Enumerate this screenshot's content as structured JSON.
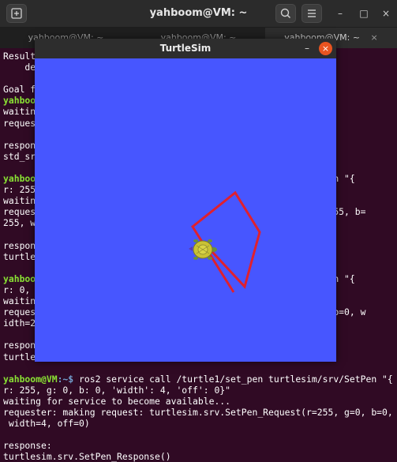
{
  "terminal": {
    "title": "yahboom@VM: ~",
    "new_tab_icon": "new-tab-icon",
    "search_icon": "search-icon",
    "menu_icon": "hamburger-menu-icon",
    "minimize_label": "–",
    "maximize_label": "□",
    "close_label": "×",
    "tabs": [
      {
        "label": "yahboom@VM: ~"
      },
      {
        "label": "yahboom@VM: ~"
      },
      {
        "label": "yahboom@VM: ~"
      }
    ],
    "tab_close_label": "×",
    "lines": [
      {
        "text": "Result"
      },
      {
        "text": "    de"
      },
      {
        "text": ""
      },
      {
        "text": "Goal f"
      },
      {
        "user": "yahboo",
        "text": ""
      },
      {
        "text": "waitin"
      },
      {
        "text": "reques"
      },
      {
        "text": ""
      },
      {
        "text": "respon"
      },
      {
        "text": "std_sr"
      },
      {
        "text": ""
      },
      {
        "user": "yahboo",
        "text": "                                                v/SetPen \"{"
      },
      {
        "text": "r: 255                                                      "
      },
      {
        "text": "waitin"
      },
      {
        "text": "reques                                                  , g=255, b="
      },
      {
        "text": "255, w"
      },
      {
        "text": ""
      },
      {
        "text": "respon"
      },
      {
        "text": "turtle"
      },
      {
        "text": ""
      },
      {
        "user": "yahboo",
        "text": "                                                v/SetPen \"{"
      },
      {
        "text": "r: 0, "
      },
      {
        "text": "waitin"
      },
      {
        "text": "reques                                                  g=0, b=0, w"
      },
      {
        "text": "idth=2"
      },
      {
        "text": ""
      },
      {
        "text": "respon"
      },
      {
        "text": "turtle"
      },
      {
        "text": ""
      },
      {
        "user": "yahboom@VM",
        "path": ":~$",
        "text": " ros2 service call /turtle1/set_pen turtlesim/srv/SetPen \"{"
      },
      {
        "text": "r: 255, g: 0, b: 0, 'width': 4, 'off': 0}\""
      },
      {
        "text": "waiting for service to become available..."
      },
      {
        "text": "requester: making request: turtlesim.srv.SetPen_Request(r=255, g=0, b=0,"
      },
      {
        "text": " width=4, off=0)"
      },
      {
        "text": ""
      },
      {
        "text": "response:"
      },
      {
        "text": "turtlesim.srv.SetPen_Response()"
      }
    ]
  },
  "turtlesim": {
    "title": "TurtleSim",
    "minimize_label": "–",
    "close_label": "×",
    "background_color": "#4756ff",
    "pen_color": "#e0202e",
    "turtle_icon": "turtle-icon"
  }
}
